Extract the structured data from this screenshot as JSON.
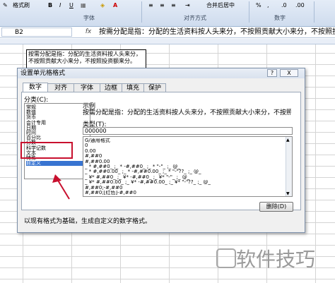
{
  "ribbon": {
    "buttons": [
      "格式刷",
      "合并后居中"
    ],
    "groups": [
      "字体",
      "对齐方式",
      "数字"
    ]
  },
  "formula_bar": {
    "name_box": "B2",
    "fx": "fx",
    "text": "按需分配是指：分配的生活资料按人头来分，不按照贡献大小来分，不按照投资"
  },
  "cell": {
    "text": "按需分配是指：分配的生活资料按人头来分，不按照贡献大小来分，不按照投资额来分。"
  },
  "dialog": {
    "title": "设置单元格格式",
    "help": "?",
    "close": "X",
    "tabs": [
      "数字",
      "对齐",
      "字体",
      "边框",
      "填充",
      "保护"
    ],
    "active_tab": "数字",
    "category_label": "分类(C):",
    "categories": [
      "常规",
      "数值",
      "货币",
      "会计专用",
      "日期",
      "时间",
      "百分比",
      "分数",
      "科学记数",
      "文本",
      "特殊",
      "自定义"
    ],
    "selected_category": "自定义",
    "sample_label": "示例",
    "sample_text": "按需分配是指：分配的生活资料按人头来分，不按照贡献大小来分，不按照投资额来",
    "type_label": "类型(T):",
    "type_value": "000000",
    "formats": [
      "G/通用格式",
      "0",
      "0.00",
      "#,##0",
      "#,##0.00",
      "_ * #,##0_ ;_ * -#,##0_ ;_ * \"-\"_ ;_ @_",
      "_ * #,##0.00_ ;_ * -#,##0.00_ ;_ * \"-\"??_ ;_ @_",
      "_ ¥* #,##0_ ;_ ¥* -#,##0_ ;_ ¥* \"-\"_ ;_ @_",
      "_ ¥* #,##0.00_ ;_ ¥* -#,##0.00_ ;_ ¥* \"-\"??_ ;_ @_",
      "#,##0;-#,##0",
      "#,##0;[红色]-#,##0"
    ],
    "delete_button": "删除(D)",
    "description": "以现有格式为基础，生成自定义的数字格式。"
  },
  "watermark": "软件技巧",
  "colors": {
    "highlight": "#c8102e",
    "selection": "#3874d1"
  }
}
